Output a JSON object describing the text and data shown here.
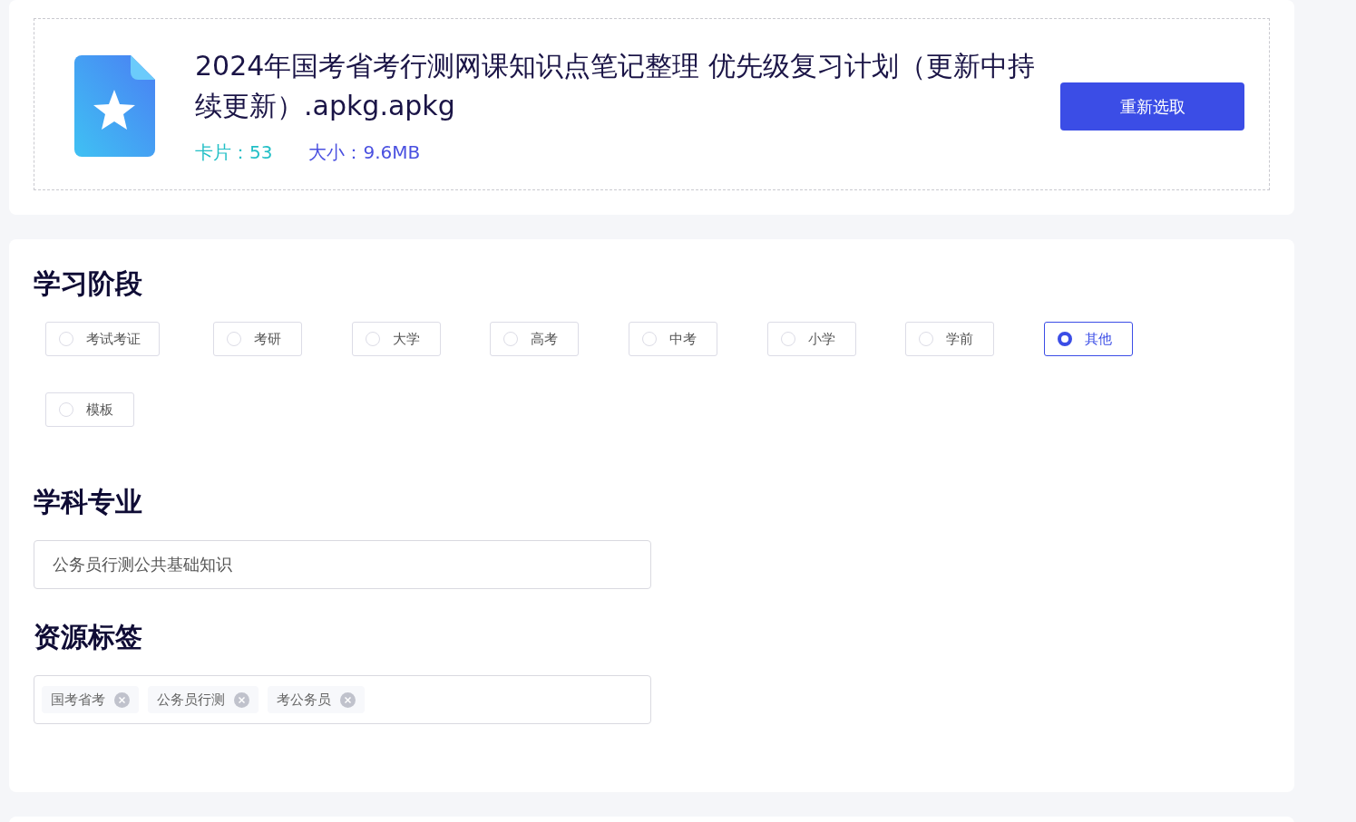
{
  "file": {
    "title": "2024年国考省考行测网课知识点笔记整理 优先级复习计划（更新中持续更新）.apkg.apkg",
    "cards_label": "卡片：",
    "cards": "53",
    "size_label": "大小：",
    "size": "9.6MB",
    "reselect_button": "重新选取"
  },
  "stage": {
    "title": "学习阶段",
    "options": [
      {
        "label": "考试考证",
        "selected": false
      },
      {
        "label": "考研",
        "selected": false
      },
      {
        "label": "大学",
        "selected": false
      },
      {
        "label": "高考",
        "selected": false
      },
      {
        "label": "中考",
        "selected": false
      },
      {
        "label": "小学",
        "selected": false
      },
      {
        "label": "学前",
        "selected": false
      },
      {
        "label": "其他",
        "selected": true
      },
      {
        "label": "模板",
        "selected": false
      }
    ]
  },
  "subject": {
    "title": "学科专业",
    "value": "公务员行测公共基础知识"
  },
  "tags": {
    "title": "资源标签",
    "items": [
      "国考省考",
      "公务员行测",
      "考公务员"
    ]
  }
}
